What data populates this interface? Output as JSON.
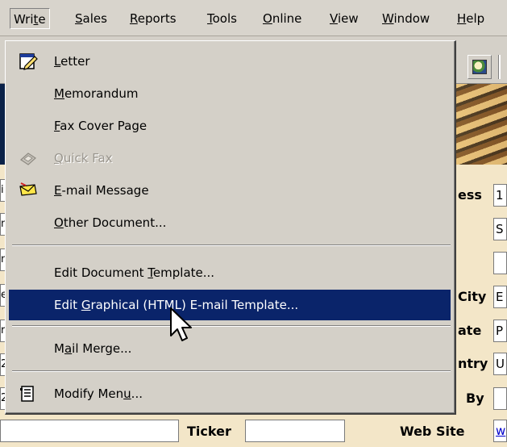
{
  "menubar": {
    "items": [
      {
        "label": "Write",
        "pre": "Wri",
        "acc": "t",
        "post": "e"
      },
      {
        "label": "Sales",
        "pre": "",
        "acc": "S",
        "post": "ales"
      },
      {
        "label": "Reports",
        "pre": "",
        "acc": "R",
        "post": "eports"
      },
      {
        "label": "Tools",
        "pre": "",
        "acc": "T",
        "post": "ools"
      },
      {
        "label": "Online",
        "pre": "",
        "acc": "O",
        "post": "nline"
      },
      {
        "label": "View",
        "pre": "",
        "acc": "V",
        "post": "iew"
      },
      {
        "label": "Window",
        "pre": "",
        "acc": "W",
        "post": "indow"
      },
      {
        "label": "Help",
        "pre": "",
        "acc": "H",
        "post": "elp"
      }
    ]
  },
  "write_menu": {
    "items": [
      {
        "pre": "",
        "acc": "L",
        "post": "etter",
        "icon": "letter-icon"
      },
      {
        "pre": "",
        "acc": "M",
        "post": "emorandum"
      },
      {
        "pre": "",
        "acc": "F",
        "post": "ax Cover Page"
      },
      {
        "pre": "",
        "acc": "Q",
        "post": "uick Fax",
        "icon": "quick-fax-icon",
        "disabled": true
      },
      {
        "pre": "",
        "acc": "E",
        "post": "-mail Message",
        "icon": "email-icon"
      },
      {
        "pre": "",
        "acc": "O",
        "post": "ther Document..."
      },
      {
        "pre": "Edit Document ",
        "acc": "T",
        "post": "emplate..."
      },
      {
        "pre": "Edit ",
        "acc": "G",
        "post": "raphical (HTML) E-mail Template...",
        "highlighted": true
      },
      {
        "pre": "M",
        "acc": "a",
        "post": "il Merge..."
      },
      {
        "pre": "Modify Men",
        "acc": "u",
        "post": "...",
        "icon": "modify-menu-icon"
      }
    ]
  },
  "background": {
    "left_fragments": [
      "i",
      "n",
      "n",
      "e",
      "r",
      "2",
      "2"
    ],
    "field_labels": [
      "ess",
      "City",
      "ate",
      "ntry",
      "By"
    ],
    "field_values": [
      "1",
      "S",
      "",
      "E",
      "P",
      "U",
      ""
    ],
    "bottom_row": {
      "ticker_label": "Ticker",
      "website_label": "Web Site",
      "website_value": "w"
    }
  },
  "colors": {
    "menu_bg": "#d4d0c8",
    "highlight": "#0a246a",
    "form_bg": "#f3e6c8"
  }
}
